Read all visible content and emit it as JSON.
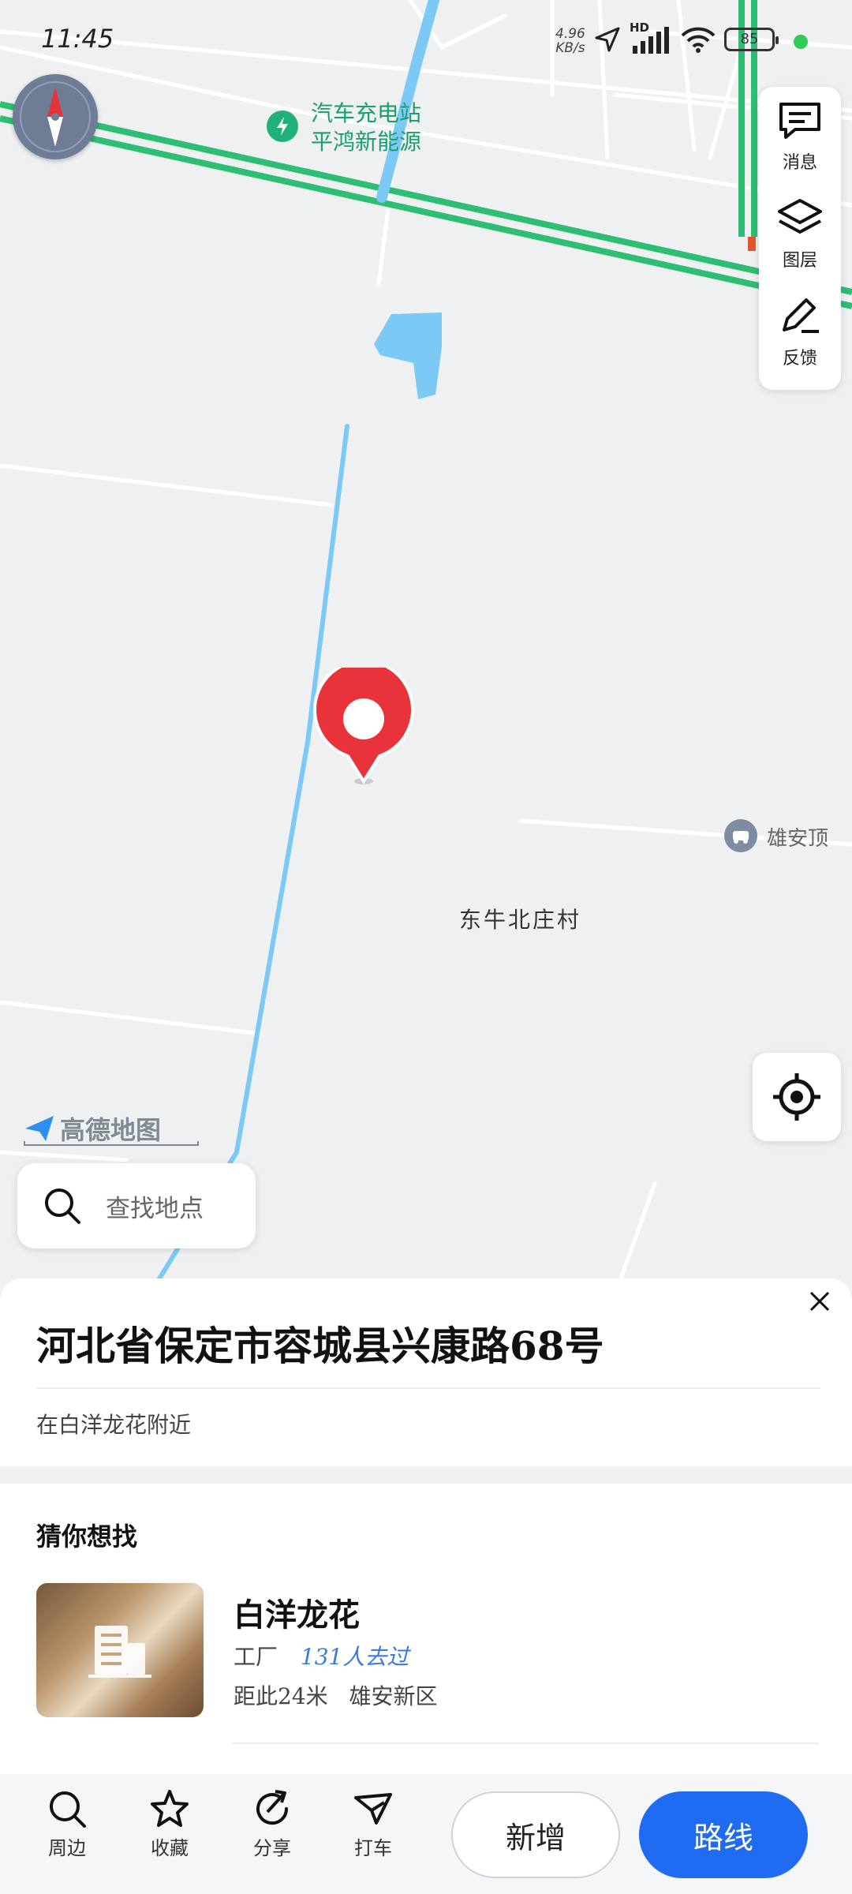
{
  "status_bar": {
    "time": "11:45",
    "net_speed_value": "4.96",
    "net_speed_unit": "KB/s",
    "battery": "85",
    "signal_label": "HD"
  },
  "map": {
    "poi_charging": {
      "line1": "汽车充电站",
      "line2": "平鸿新能源"
    },
    "village_label": "东牛北庄村",
    "poi_right_label": "雄安顶",
    "logo_text": "高德地图"
  },
  "toolbar": {
    "messages_label": "消息",
    "layers_label": "图层",
    "feedback_label": "反馈"
  },
  "search": {
    "placeholder": "查找地点"
  },
  "place": {
    "address": "河北省保定市容城县兴康路68号",
    "nearby": "在白洋龙花附近"
  },
  "guess": {
    "title": "猜你想找",
    "item": {
      "name": "白洋龙花",
      "category": "工厂",
      "visits": "131人去过",
      "distance": "距此24米",
      "district": "雄安新区"
    }
  },
  "bottom_bar": {
    "nearby": "周边",
    "favorite": "收藏",
    "share": "分享",
    "checkin": "打车",
    "add": "新增",
    "route": "路线"
  },
  "colors": {
    "accent": "#1f6cf2",
    "pin": "#e8333a",
    "road_green": "#2dbd73",
    "water": "#7cc9f5"
  }
}
